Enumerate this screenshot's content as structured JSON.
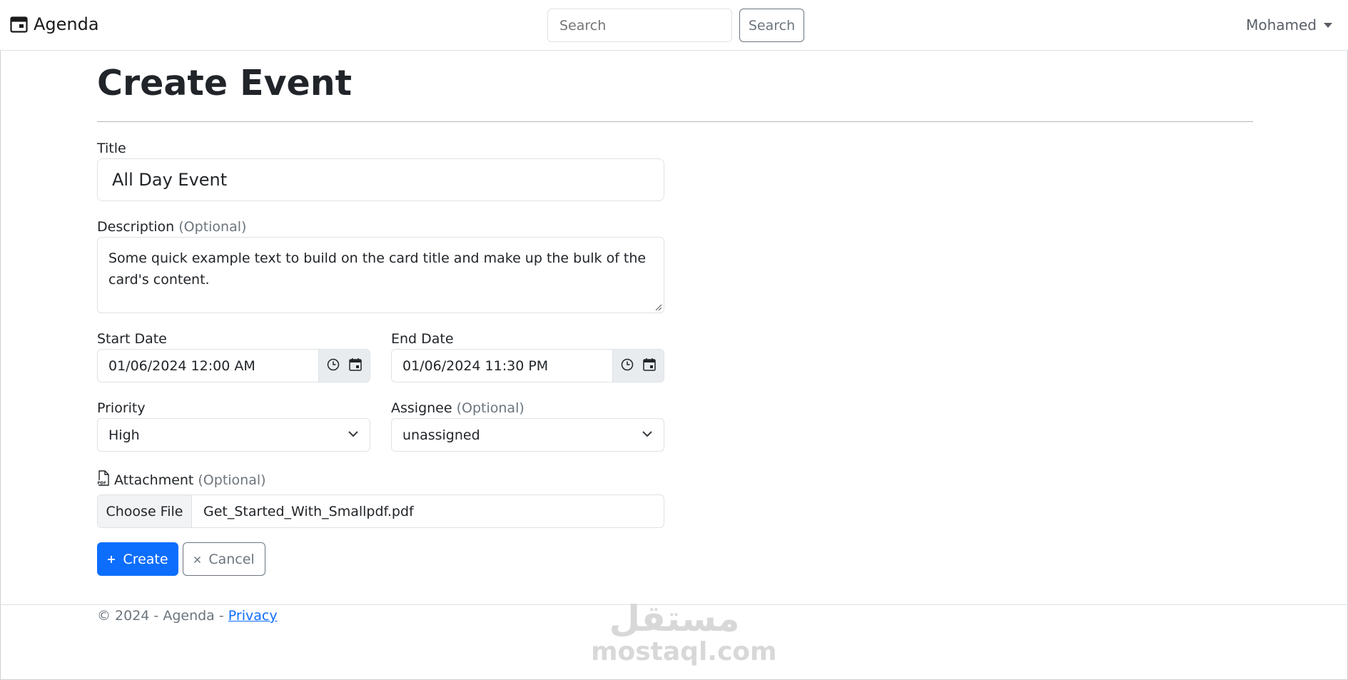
{
  "nav": {
    "brand": "Agenda",
    "search_placeholder": "Search",
    "search_button": "Search",
    "user": "Mohamed"
  },
  "page": {
    "title": "Create Event"
  },
  "form": {
    "title_label": "Title",
    "title_value": "All Day Event",
    "description_label": "Description",
    "optional": "(Optional)",
    "description_value": "Some quick example text to build on the card title and make up the bulk of the card's content.",
    "start_label": "Start Date",
    "start_value": "01/06/2024 12:00 AM",
    "end_label": "End Date",
    "end_value": "01/06/2024 11:30 PM",
    "priority_label": "Priority",
    "priority_value": "High",
    "assignee_label": "Assignee",
    "assignee_value": "unassigned",
    "attachment_label": "Attachment",
    "choose_file": "Choose File",
    "file_name": "Get_Started_With_Smallpdf.pdf",
    "create_button": "Create",
    "cancel_button": "Cancel"
  },
  "footer": {
    "text": "© 2024 - Agenda - ",
    "privacy": "Privacy"
  },
  "watermark": {
    "arabic": "مستقل",
    "latin": "mostaql.com"
  },
  "icons": {
    "brand": "calendar-icon",
    "clock": "clock-icon",
    "calendar": "calendar-icon",
    "chevron": "chevron-down-icon",
    "pdf": "pdf-file-icon",
    "plus": "plus-icon",
    "close": "close-icon"
  },
  "colors": {
    "primary": "#0d6efd",
    "secondary": "#6c757d",
    "accent": "#e0242b"
  }
}
